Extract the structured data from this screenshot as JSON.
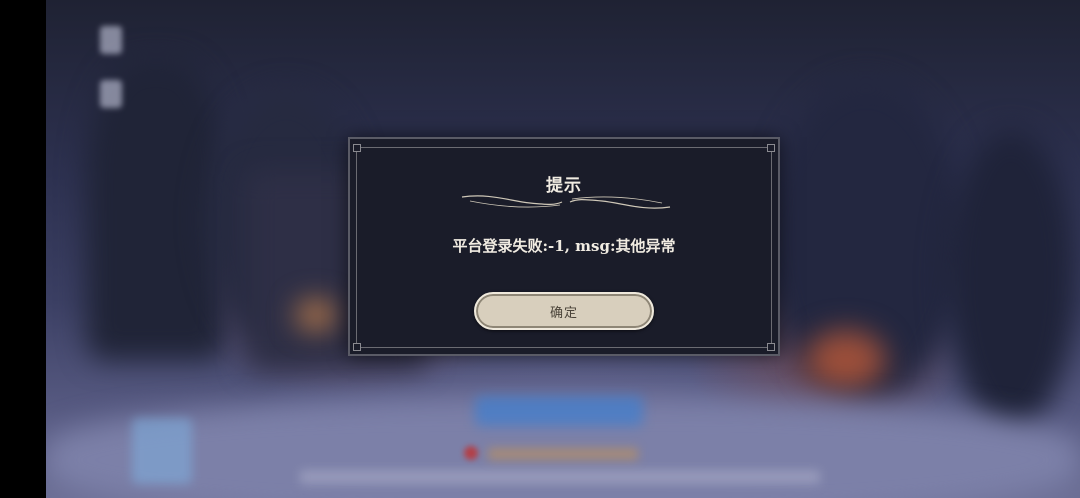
{
  "dialog": {
    "title": "提示",
    "message": "平台登录失败:-1, msg:其他异常",
    "confirm_label": "确定"
  },
  "colors": {
    "dialog_background": "#1a1c29",
    "dialog_border": "#5a5b66",
    "text": "#f1ece2",
    "button_background": "#d8cfbd",
    "button_text": "#4a4339"
  }
}
